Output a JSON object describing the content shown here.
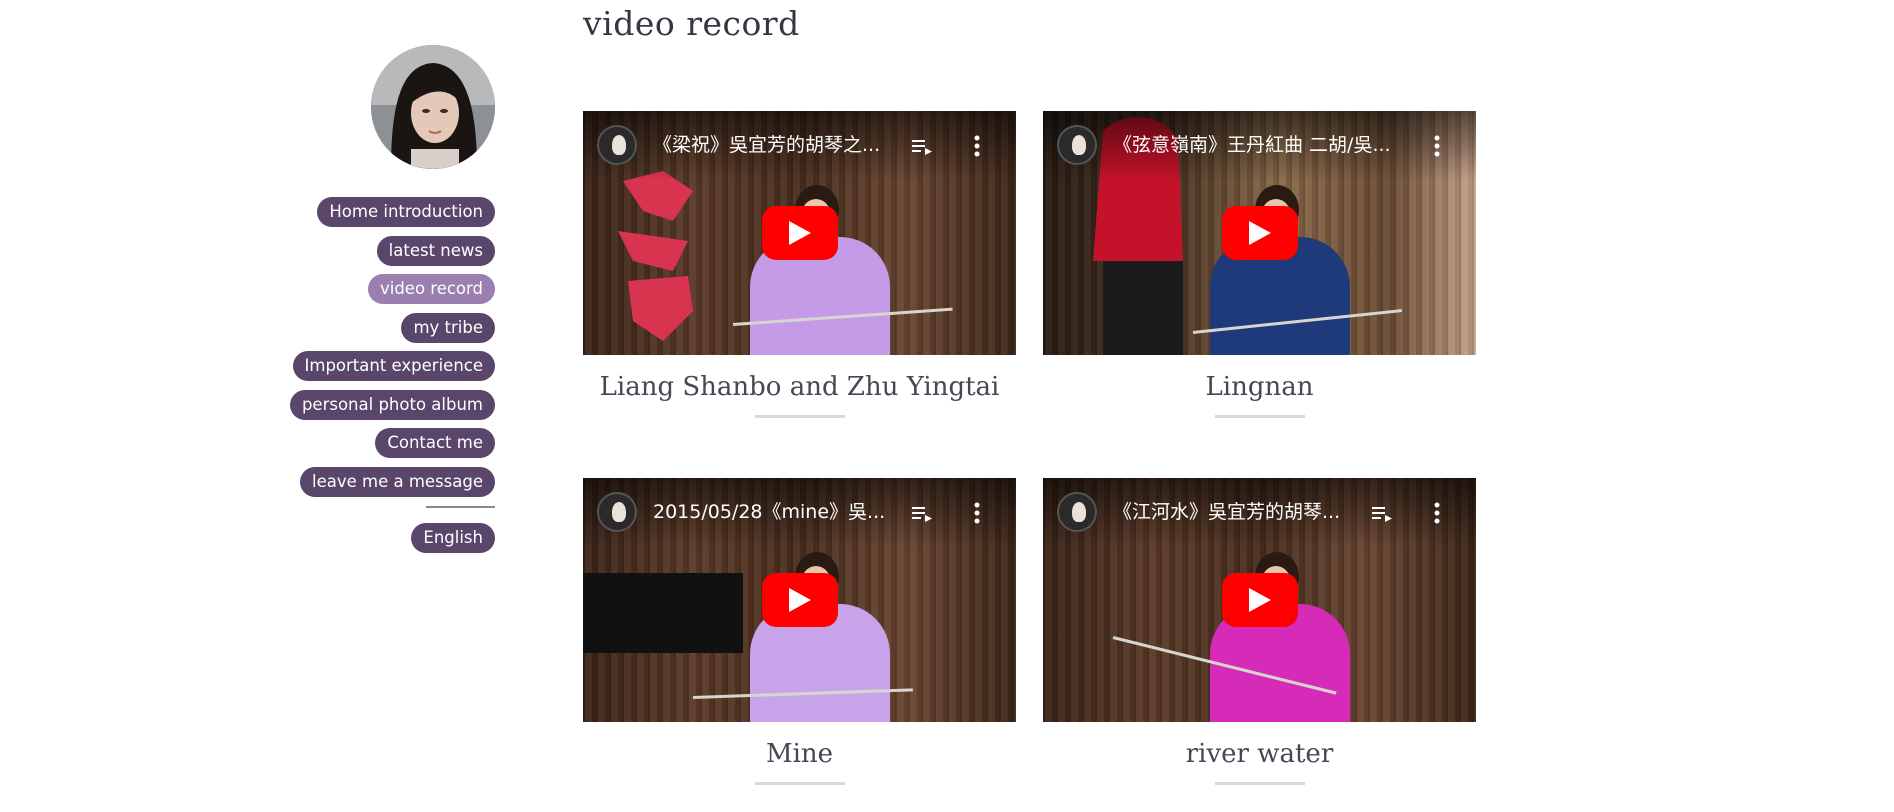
{
  "page_title": "video record",
  "sidebar": {
    "nav": [
      {
        "label": "Home introduction",
        "active": false
      },
      {
        "label": "latest news",
        "active": false
      },
      {
        "label": "video record",
        "active": true
      },
      {
        "label": "my tribe",
        "active": false
      },
      {
        "label": "Important experience",
        "active": false
      },
      {
        "label": "personal photo album",
        "active": false
      },
      {
        "label": "Contact me",
        "active": false
      },
      {
        "label": "leave me a message",
        "active": false
      }
    ],
    "language": "English"
  },
  "videos": [
    {
      "yt_title": "《梁祝》吳宜芳的胡琴之...",
      "caption": "Liang Shanbo and Zhu Yingtai",
      "dress_color": "#c59be8"
    },
    {
      "yt_title": "《弦意嶺南》王丹紅曲 二胡/吳...",
      "caption": "Lingnan",
      "dress_color": "#1f3a7a"
    },
    {
      "yt_title": "2015/05/28《mine》吳...",
      "caption": "Mine",
      "dress_color": "#c9a3ea"
    },
    {
      "yt_title": "《江河水》吳宜芳的胡琴...",
      "caption": "river water",
      "dress_color": "#d52bb8"
    }
  ],
  "colors": {
    "nav_bg": "#5b466b",
    "nav_active_bg": "#9b7fb1",
    "yt_red": "#ff0000"
  },
  "icons": {
    "play": "play-icon",
    "playlist": "playlist-icon",
    "menu": "more-vert-icon"
  }
}
